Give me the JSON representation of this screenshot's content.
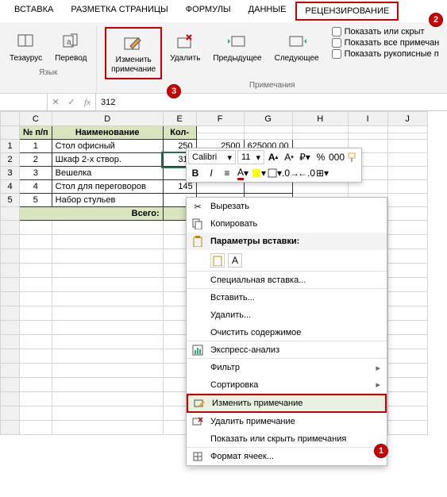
{
  "ribbon": {
    "tabs": [
      "ВСТАВКА",
      "РАЗМЕТКА СТРАНИЦЫ",
      "ФОРМУЛЫ",
      "ДАННЫЕ",
      "РЕЦЕНЗИРОВАНИЕ"
    ],
    "active_tab": 4,
    "group1": {
      "name": "Язык",
      "btn1": "Тезаурус",
      "btn2": "Перевод"
    },
    "group2": {
      "name": "Примечания",
      "btn_edit": "Изменить примечание",
      "btn_edit_line1": "Изменить",
      "btn_edit_line2": "примечание",
      "btn_delete": "Удалить",
      "btn_prev": "Предыдущее",
      "btn_next": "Следующее"
    },
    "side": {
      "show_hide": "Показать или скрыт",
      "show_all": "Показать все примечан",
      "show_ink": "Показать рукописные п"
    }
  },
  "badges": {
    "b1": "1",
    "b2": "2",
    "b3": "3"
  },
  "formula": {
    "fx": "fx",
    "value": "312"
  },
  "columns": [
    "C",
    "D",
    "E",
    "F",
    "G",
    "H",
    "I",
    "J"
  ],
  "rows_idx": [
    "",
    "",
    "1",
    "2",
    "3",
    "4",
    "5",
    "",
    "",
    "",
    "",
    "",
    "",
    "",
    "",
    "",
    "",
    "",
    "",
    "",
    "",
    "",
    ""
  ],
  "headers": {
    "num": "№ п/п",
    "name": "Наименование",
    "qty": "Кол-"
  },
  "data": [
    {
      "n": "1",
      "name": "Стол офисный",
      "qty": "250"
    },
    {
      "n": "2",
      "name": "Шкаф 2-х створ.",
      "qty": "312"
    },
    {
      "n": "3",
      "name": "Вешелка",
      "qty": ""
    },
    {
      "n": "4",
      "name": "Стол для переговоров",
      "qty": "145"
    },
    {
      "n": "5",
      "name": "Набор стульев",
      "qty": ""
    }
  ],
  "totals_label": "Всего:",
  "obscured": {
    "f_val": "2500",
    "g_val": "625000,00"
  },
  "mini": {
    "font": "Calibri",
    "size": "11",
    "icons": {
      "bold": "A",
      "inc": "A",
      "dec": "A",
      "fmt": "%",
      "sep": "000",
      "dot": ".0"
    }
  },
  "ctx": {
    "cut": "Вырезать",
    "copy": "Копировать",
    "paste_opts": "Параметры вставки:",
    "paste_special": "Специальная вставка...",
    "insert": "Вставить...",
    "delete": "Удалить...",
    "clear": "Очистить содержимое",
    "quick": "Экспресс-анализ",
    "filter": "Фильтр",
    "sort": "Сортировка",
    "edit_note": "Изменить примечание",
    "del_note": "Удалить примечание",
    "show_note": "Показать или скрыть примечания",
    "format": "Формат ячеек...",
    "filter_key": "Фильтр"
  }
}
